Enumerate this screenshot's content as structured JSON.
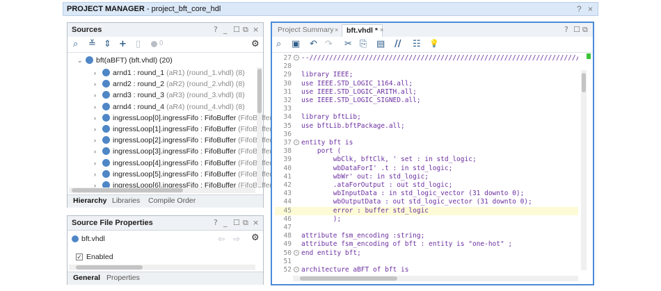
{
  "window": {
    "title_prefix": "PROJECT MANAGER",
    "title_suffix": " - project_bft_core_hdl",
    "help": "?",
    "close": "×"
  },
  "sources": {
    "title": "Sources",
    "controls": [
      "?",
      "_",
      "☐",
      "⧉",
      "×"
    ],
    "count_badge": "0",
    "root": "bft(aBFT) (bft.vhdl) (20)",
    "rows": [
      {
        "name": "arnd1 : round_1",
        "meta": "(aR1) (round_1.vhdl) (8)"
      },
      {
        "name": "arnd2 : round_2",
        "meta": "(aR2) (round_2.vhdl) (8)"
      },
      {
        "name": "arnd3 : round_3",
        "meta": "(aR3) (round_3.vhdl) (8)"
      },
      {
        "name": "arnd4 : round_4",
        "meta": "(aR4) (round_4.vhdl) (8)"
      },
      {
        "name": "ingressLoop[0].ingressFifo : FifoBuffer",
        "meta": "(FifoBuffer.v) ("
      },
      {
        "name": "ingressLoop[1].ingressFifo : FifoBuffer",
        "meta": "(FifoBuffer.v) ("
      },
      {
        "name": "ingressLoop[2].ingressFifo : FifoBuffer",
        "meta": "(FifoBuffer.v) ("
      },
      {
        "name": "ingressLoop[3].ingressFifo : FifoBuffer",
        "meta": "(FifoBuffer.v) ("
      },
      {
        "name": "ingressLoop[4].ingressFifo : FifoBuffer",
        "meta": "(FifoBuffer.v) ("
      },
      {
        "name": "ingressLoop[5].ingressFifo : FifoBuffer",
        "meta": "(FifoBuffer.v) ("
      },
      {
        "name": "ingressLoop[6].ingressFifo : FifoBuffer",
        "meta": "(FifoBuffer.v) ("
      }
    ],
    "tabs": [
      "Hierarchy",
      "Libraries",
      "Compile Order"
    ]
  },
  "props": {
    "title": "Source File Properties",
    "controls": [
      "?",
      "_",
      "☐",
      "⧉",
      "×"
    ],
    "file": "bft.vhdl",
    "enabled_label": "Enabled",
    "tabs": [
      "General",
      "Properties"
    ]
  },
  "editor": {
    "tab_summary": "Project Summary",
    "tab_file": "bft.vhdl *",
    "tab_close": "×",
    "controls": [
      "?",
      "☐",
      "⧉"
    ],
    "lines": [
      {
        "n": "27",
        "t": "--//////////////////////////////////////////////////////////////////////////",
        "fold": true
      },
      {
        "n": "28",
        "t": ""
      },
      {
        "n": "29",
        "t": "library IEEE;"
      },
      {
        "n": "30",
        "t": "use IEEE.STD_LOGIC_1164.all;"
      },
      {
        "n": "31",
        "t": "use IEEE.STD_LOGIC_ARITH.all;"
      },
      {
        "n": "32",
        "t": "use IEEE.STD_LOGIC_SIGNED.all;"
      },
      {
        "n": "33",
        "t": ""
      },
      {
        "n": "34",
        "t": "library bftLib;"
      },
      {
        "n": "35",
        "t": "use bftLib.bftPackage.all;"
      },
      {
        "n": "36",
        "t": ""
      },
      {
        "n": "37",
        "t": "entity bft is",
        "fold": true
      },
      {
        "n": "38",
        "t": "    port ("
      },
      {
        "n": "39",
        "t": "        wbClk, bftClk, ' set : in std_logic;"
      },
      {
        "n": "40",
        "t": "        wbDataForI' .t : in std_logic;"
      },
      {
        "n": "41",
        "t": "        wbWr' out: in std_logic;"
      },
      {
        "n": "42",
        "t": "        .ataForOutput : out std_logic;"
      },
      {
        "n": "43",
        "t": "        wbInputData : in std_logic_vector (31 downto 0);"
      },
      {
        "n": "44",
        "t": "        wbOutputData : out std_logic_vector (31 downto 0);"
      },
      {
        "n": "45",
        "t": "        error : buffer std_logic",
        "hl": true
      },
      {
        "n": "46",
        "t": "        );"
      },
      {
        "n": "47",
        "t": ""
      },
      {
        "n": "48",
        "t": "attribute fsm_encoding :string;"
      },
      {
        "n": "49",
        "t": "attribute fsm_encoding of bft : entity is \"one-hot\" ;"
      },
      {
        "n": "50",
        "t": "end entity bft;",
        "fold": true
      },
      {
        "n": "51",
        "t": ""
      },
      {
        "n": "52",
        "t": "architecture aBFT of bft is",
        "fold": true
      }
    ]
  },
  "icons": {
    "search": "⌕",
    "collapse": "≚",
    "expand": "⇕",
    "add": "+",
    "file": "▯",
    "gear": "⚙",
    "save": "▣",
    "undo": "↶",
    "redo": "↷",
    "cut": "✂",
    "copy": "⎘",
    "paste": "▤",
    "comment": "//",
    "list": "☷",
    "bulb": "💡"
  },
  "colors": {
    "accent": "#2e5d8a",
    "keyword": "#6b2fa0",
    "highlight": "#fdfbd6",
    "title_bg": "#dbe8f7"
  }
}
